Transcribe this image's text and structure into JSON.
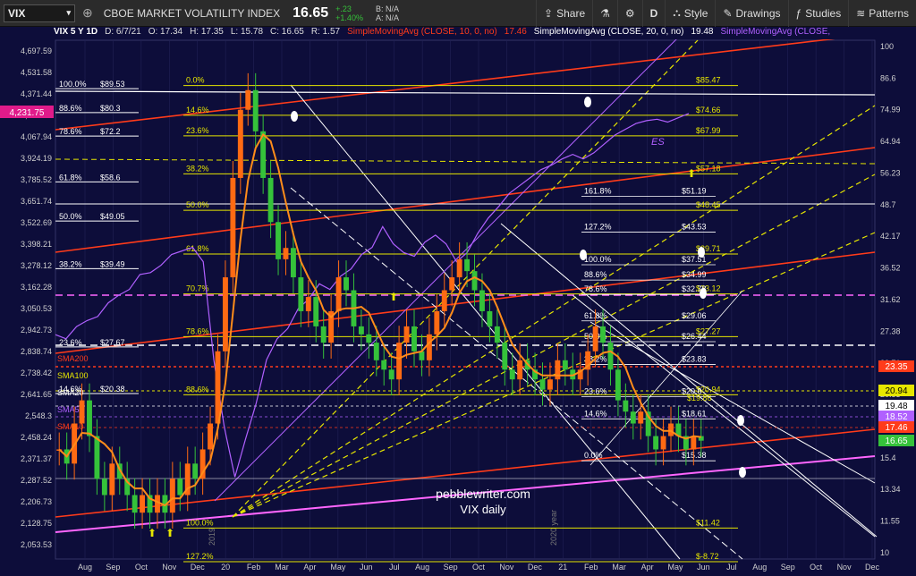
{
  "toolbar": {
    "symbol": "VIX",
    "name": "CBOE MARKET VOLATILITY INDEX",
    "price": "16.65",
    "change": "+.23",
    "change_pct": "+1.40%",
    "bid": "B: N/A",
    "ask": "A: N/A",
    "share": "Share",
    "timeframe": "D",
    "style": "Style",
    "drawings": "Drawings",
    "studies": "Studies",
    "patterns": "Patterns"
  },
  "header": {
    "series": "VIX 5 Y 1D",
    "date": "D: 6/7/21",
    "open": "O: 17.34",
    "high": "H: 17.35",
    "low": "L: 15.78",
    "close": "C: 16.65",
    "range": "R: 1.57",
    "sma10": "SimpleMovingAvg (CLOSE, 10, 0, no)",
    "sma10_val": "17.46",
    "sma20": "SimpleMovingAvg (CLOSE, 20, 0, no)",
    "sma20_val": "19.48",
    "sma50": "SimpleMovingAvg (CLOSE,"
  },
  "colors": {
    "background": "#0d0d3a",
    "fib_yellow": "#e6e600",
    "channel_red": "#ff3b1a",
    "spx_purple": "#b060ff",
    "candle_up": "#35c23a",
    "candle_down": "#ff6a13",
    "pink_channel": "#ff66ff"
  },
  "chart_data": {
    "type": "line",
    "title": "pebblewriter.com",
    "subtitle": "VIX daily",
    "left_axis_ticks": [
      "4,697.59",
      "4,531.58",
      "4,371.44",
      "4,231.75",
      "4,067.94",
      "3,924.19",
      "3,785.52",
      "3,651.74",
      "3,522.69",
      "3,398.21",
      "3,278.12",
      "3,162.28",
      "3,050.53",
      "2,942.73",
      "2,838.74",
      "2,738.42",
      "2,641.65",
      "2,548.3",
      "2,458.24",
      "2,371.37",
      "2,287.52",
      "2,206.73",
      "2,128.75",
      "2,053.53"
    ],
    "right_axis_ticks": [
      "100",
      "86.6",
      "74.99",
      "64.94",
      "56.23",
      "48.7",
      "42.17",
      "36.52",
      "31.62",
      "27.38",
      "23.71",
      "20.53",
      "17.78",
      "15.4",
      "13.34",
      "11.55",
      "10"
    ],
    "x_ticks": [
      "Aug",
      "Sep",
      "Oct",
      "Nov",
      "Dec",
      "20",
      "Feb",
      "Mar",
      "Apr",
      "May",
      "Jun",
      "Jul",
      "Aug",
      "Sep",
      "Oct",
      "Nov",
      "Dec",
      "21",
      "Feb",
      "Mar",
      "Apr",
      "May",
      "Jun",
      "Jul",
      "Aug",
      "Sep",
      "Oct",
      "Nov",
      "Dec"
    ],
    "year_marks": [
      "2019",
      "2020 year"
    ],
    "right_badges": [
      {
        "label": "23.35",
        "color": "#ff3b1a"
      },
      {
        "label": "20.94",
        "color": "#e6e600"
      },
      {
        "label": "19.48",
        "color": "#ffffff"
      },
      {
        "label": "18.52",
        "color": "#b060ff"
      },
      {
        "label": "17.46",
        "color": "#ff3b1a"
      },
      {
        "label": "16.65",
        "color": "#35c23a"
      }
    ],
    "last_price_left": "4,231.75",
    "fib_left": [
      {
        "pct": "100.0%",
        "val": "$89.53",
        "price": 89.53
      },
      {
        "pct": "88.6%",
        "val": "$80.3",
        "price": 80.3
      },
      {
        "pct": "78.6%",
        "val": "$72.2",
        "price": 72.2
      },
      {
        "pct": "61.8%",
        "val": "$58.6",
        "price": 58.6
      },
      {
        "pct": "50.0%",
        "val": "$49.05",
        "price": 49.05
      },
      {
        "pct": "38.2%",
        "val": "$39.49",
        "price": 39.49
      },
      {
        "pct": "23.6%",
        "val": "$27.67",
        "price": 27.67
      },
      {
        "pct": "14.6%",
        "val": "$20.38",
        "price": 20.38
      }
    ],
    "fib_center": [
      {
        "pct": "0.0%",
        "val": "$85.47",
        "price": 85.47
      },
      {
        "pct": "14.6%",
        "val": "$74.66",
        "price": 74.66
      },
      {
        "pct": "23.6%",
        "val": "$67.99",
        "price": 67.99
      },
      {
        "pct": "38.2%",
        "val": "$57.18",
        "price": 57.18
      },
      {
        "pct": "50.0%",
        "val": "$48.45",
        "price": 48.45
      },
      {
        "pct": "61.8%",
        "val": "$39.71",
        "price": 39.71
      },
      {
        "pct": "70.7%",
        "val": "$33.12",
        "price": 33.12
      },
      {
        "pct": "78.6%",
        "val": "$27.27",
        "price": 27.27
      },
      {
        "pct": "88.6%",
        "val": "$20.94",
        "price": 20.94
      },
      {
        "pct": "100.0%",
        "val": "$11.42",
        "price": 11.42
      },
      {
        "pct": "127.2%",
        "val": "$-8.72",
        "price": 9.8
      }
    ],
    "fib_right": [
      {
        "pct": "161.8%",
        "val": "$51.19",
        "price": 51.19
      },
      {
        "pct": "127.2%",
        "val": "$43.53",
        "price": 43.53
      },
      {
        "pct": "100.0%",
        "val": "$37.51",
        "price": 37.51
      },
      {
        "pct": "88.6%",
        "val": "$34.99",
        "price": 34.99
      },
      {
        "pct": "78.6%",
        "val": "$32.78",
        "price": 32.78
      },
      {
        "pct": "61.8%",
        "val": "$29.06",
        "price": 29.06
      },
      {
        "pct": "50.0%",
        "val": "$26.44",
        "price": 26.44
      },
      {
        "pct": "38.2%",
        "val": "$23.83",
        "price": 23.83
      },
      {
        "pct": "23.6%",
        "val": "$20.6",
        "price": 20.6
      },
      {
        "pct": "14.6%",
        "val": "$18.61",
        "price": 18.61
      },
      {
        "pct": "0.0%",
        "val": "$15.38",
        "price": 15.38
      }
    ],
    "extra_right_vals": [
      "$19.86"
    ],
    "sma_labels": [
      "SMA200",
      "SMA100",
      "SMA20",
      "SMA50",
      "SMA10"
    ],
    "es_label": "ES",
    "vix_closes": [
      16,
      15,
      18,
      20,
      17,
      14,
      13,
      15,
      14,
      13,
      12,
      13,
      12,
      13,
      12,
      14,
      13,
      15,
      14,
      16,
      18,
      25,
      35,
      55,
      75,
      82,
      68,
      55,
      45,
      38,
      40,
      35,
      30,
      32,
      28,
      26,
      30,
      35,
      33,
      28,
      27,
      26,
      24,
      23,
      22,
      26,
      28,
      25,
      24,
      27,
      30,
      33,
      35,
      38,
      36,
      33,
      30,
      28,
      26,
      23,
      22,
      24,
      23,
      22,
      21,
      22,
      24,
      23,
      22,
      23,
      25,
      28,
      26,
      23,
      20,
      19,
      18,
      19,
      17,
      16,
      17,
      18,
      17,
      16,
      17,
      16.65
    ],
    "spx_closes": [
      2920,
      2900,
      2960,
      2990,
      3010,
      3080,
      3120,
      3150,
      3230,
      3240,
      3280,
      3340,
      3360,
      3380,
      3300,
      2800,
      2500,
      2300,
      2450,
      2600,
      2800,
      2900,
      2950,
      3050,
      3100,
      3180,
      3150,
      3220,
      3260,
      3340,
      3380,
      3500,
      3400,
      3350,
      3330,
      3410,
      3450,
      3400,
      3300,
      3350,
      3460,
      3550,
      3620,
      3700,
      3750,
      3800,
      3850,
      3880,
      3920,
      3950,
      3920,
      3960,
      4020,
      4080,
      4120,
      4160,
      4180,
      4190,
      4170,
      4200,
      4230
    ]
  }
}
